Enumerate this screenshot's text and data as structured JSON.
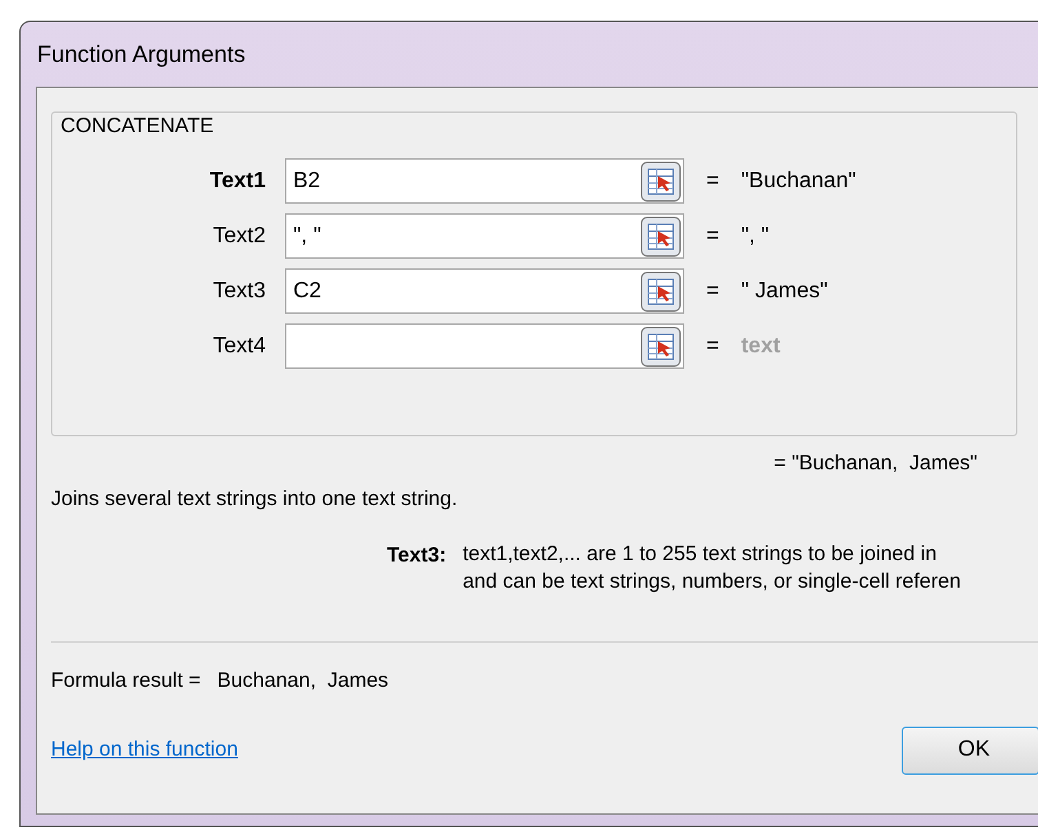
{
  "window": {
    "title": "Function Arguments"
  },
  "function_name": "CONCATENATE",
  "arguments": [
    {
      "label": "Text1",
      "value": "B2",
      "equals": "=",
      "result": "\"Buchanan\"",
      "current": true,
      "result_is_hint": false
    },
    {
      "label": "Text2",
      "value": "\", \"",
      "equals": "=",
      "result": "\", \"",
      "current": false,
      "result_is_hint": false
    },
    {
      "label": "Text3",
      "value": "C2",
      "equals": "=",
      "result": "\" James\"",
      "current": false,
      "result_is_hint": false
    },
    {
      "label": "Text4",
      "equals": "=",
      "result": "text",
      "current": false,
      "result_is_hint": true
    }
  ],
  "overall_result": "= \"Buchanan,  James\"",
  "description": "Joins several text strings into one text string.",
  "argument_help": {
    "label": "Text3:",
    "lines": [
      "text1,text2,... are 1 to 255 text strings to be joined in",
      "and can be text strings, numbers, or single-cell referen"
    ]
  },
  "formula_result": {
    "label": "Formula result =",
    "value": "Buchanan,  James"
  },
  "help_link": "Help on this function",
  "buttons": [
    "OK"
  ]
}
